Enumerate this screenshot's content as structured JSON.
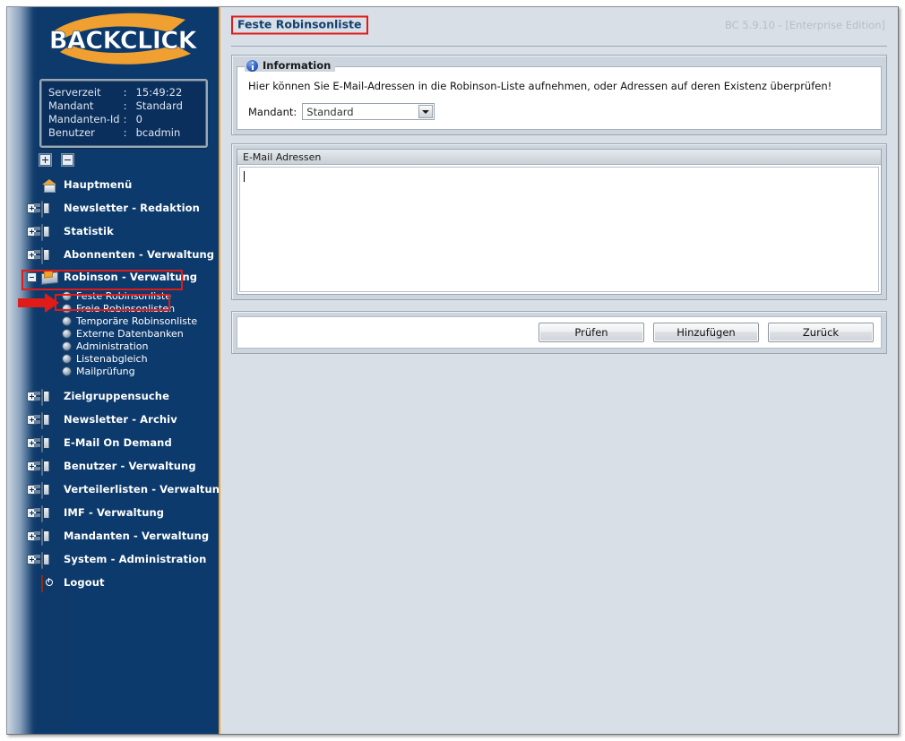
{
  "app": {
    "logo_text": "BACKCLICK",
    "version": "BC 5.9.10 - [Enterprise Edition]"
  },
  "serverinfo": {
    "rows": [
      {
        "key": "Serverzeit",
        "sep": ":",
        "value": "15:49:22"
      },
      {
        "key": "Mandant",
        "sep": ":",
        "value": "Standard"
      },
      {
        "key": "Mandanten-Id",
        "sep": ":",
        "value": "0"
      },
      {
        "key": "Benutzer",
        "sep": ":",
        "value": "bcadmin"
      }
    ]
  },
  "tree_controls": {
    "expand_all": "+",
    "collapse_all": "-"
  },
  "sidebar": {
    "items": [
      {
        "label": "Hauptmenü",
        "icon": "home-icon",
        "expander": "none",
        "selected": false
      },
      {
        "label": "Newsletter - Redaktion",
        "icon": "folder-icon",
        "expander": "plus",
        "selected": false
      },
      {
        "label": "Statistik",
        "icon": "folder-icon",
        "expander": "plus",
        "selected": false
      },
      {
        "label": "Abonnenten - Verwaltung",
        "icon": "folder-icon",
        "expander": "plus",
        "selected": false
      },
      {
        "label": "Robinson - Verwaltung",
        "icon": "robinson-icon",
        "expander": "minus",
        "selected": true
      },
      {
        "label": "Zielgruppensuche",
        "icon": "folder-icon",
        "expander": "plus",
        "selected": false
      },
      {
        "label": "Newsletter - Archiv",
        "icon": "folder-icon",
        "expander": "plus",
        "selected": false
      },
      {
        "label": "E-Mail On Demand",
        "icon": "folder-icon",
        "expander": "plus",
        "selected": false
      },
      {
        "label": "Benutzer - Verwaltung",
        "icon": "folder-icon",
        "expander": "plus",
        "selected": false
      },
      {
        "label": "Verteilerlisten - Verwaltung",
        "icon": "folder-icon",
        "expander": "plus",
        "selected": false
      },
      {
        "label": "IMF - Verwaltung",
        "icon": "folder-icon",
        "expander": "plus",
        "selected": false
      },
      {
        "label": "Mandanten - Verwaltung",
        "icon": "folder-icon",
        "expander": "plus",
        "selected": false
      },
      {
        "label": "System - Administration",
        "icon": "folder-icon",
        "expander": "plus",
        "selected": false
      },
      {
        "label": "Logout",
        "icon": "logout-icon",
        "expander": "none",
        "selected": false
      }
    ],
    "robinson_submenu": [
      {
        "label": "Feste Robinsonliste",
        "active": true
      },
      {
        "label": "Freie Robinsonlisten",
        "active": false
      },
      {
        "label": "Temporäre Robinsonliste",
        "active": false
      },
      {
        "label": "Externe Datenbanken",
        "active": false
      },
      {
        "label": "Administration",
        "active": false
      },
      {
        "label": "Listenabgleich",
        "active": false
      },
      {
        "label": "Mailprüfung",
        "active": false
      }
    ]
  },
  "main": {
    "page_title": "Feste Robinsonliste",
    "information": {
      "legend": "Information",
      "text": "Hier können Sie E-Mail-Adressen in die Robinson-Liste aufnehmen, oder Adressen auf deren Existenz überprüfen!",
      "mandant_label": "Mandant:",
      "mandant_value": "Standard",
      "mandant_options": [
        "Standard"
      ]
    },
    "addresses": {
      "header": "E-Mail Adressen",
      "value": "",
      "placeholder": ""
    },
    "buttons": [
      {
        "label": "Prüfen"
      },
      {
        "label": "Hinzufügen"
      },
      {
        "label": "Zurück"
      }
    ]
  },
  "colors": {
    "sidebar_blue": "#0c3a6d",
    "accent_orange": "#f0a030",
    "highlight_red": "#e01b18",
    "panel_bg": "#d9dfe6",
    "title_blue": "#12406e"
  }
}
